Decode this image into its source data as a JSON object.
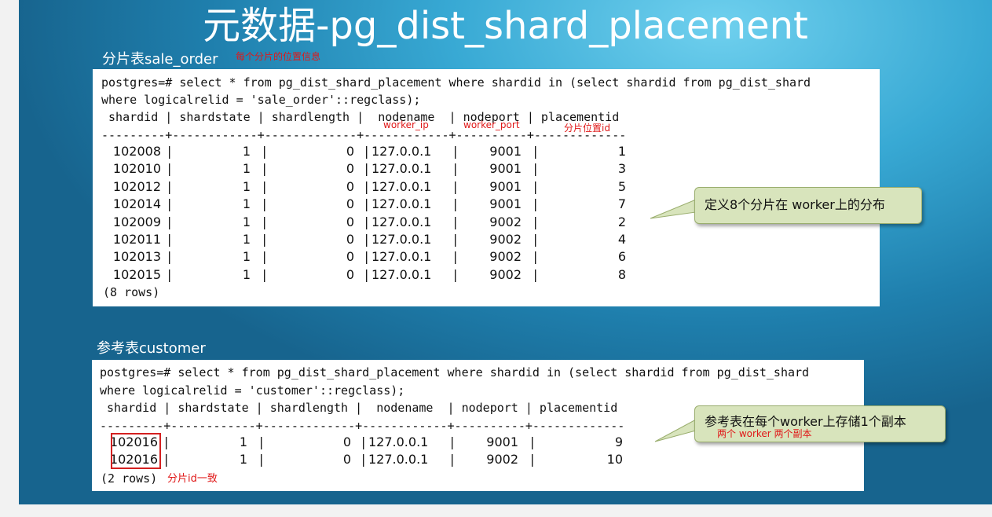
{
  "title": "元数据-pg_dist_shard_placement",
  "section1": {
    "label": "分片表sale_order",
    "note": "每个分片的位置信息",
    "query_line1": "postgres=# select * from pg_dist_shard_placement where shardid in (select shardid from pg_dist_shard",
    "query_line2": "where logicalrelid = 'sale_order'::regclass);",
    "header": " shardid | shardstate | shardlength |  nodename  | nodeport | placementid",
    "header_notes": {
      "nodename": "worker_ip",
      "nodeport": "worker_port",
      "placementid": "分片位置id"
    },
    "separator": "---------+------------+-------------+------------+----------+-------------",
    "rows": [
      [
        "102008",
        "1",
        "0",
        "127.0.0.1",
        "9001",
        "1"
      ],
      [
        "102010",
        "1",
        "0",
        "127.0.0.1",
        "9001",
        "3"
      ],
      [
        "102012",
        "1",
        "0",
        "127.0.0.1",
        "9001",
        "5"
      ],
      [
        "102014",
        "1",
        "0",
        "127.0.0.1",
        "9001",
        "7"
      ],
      [
        "102009",
        "1",
        "0",
        "127.0.0.1",
        "9002",
        "2"
      ],
      [
        "102011",
        "1",
        "0",
        "127.0.0.1",
        "9002",
        "4"
      ],
      [
        "102013",
        "1",
        "0",
        "127.0.0.1",
        "9002",
        "6"
      ],
      [
        "102015",
        "1",
        "0",
        "127.0.0.1",
        "9002",
        "8"
      ]
    ],
    "footer": "(8 rows)",
    "callout": "定义8个分片在 worker上的分布"
  },
  "section2": {
    "label": "参考表customer",
    "query_line1": "postgres=# select * from pg_dist_shard_placement where shardid in (select shardid from pg_dist_shard",
    "query_line2": "where logicalrelid = 'customer'::regclass);",
    "header": " shardid | shardstate | shardlength |  nodename  | nodeport | placementid",
    "separator": "---------+------------+-------------+------------+----------+-------------",
    "rows": [
      [
        "102016",
        "1",
        "0",
        "127.0.0.1",
        "9001",
        "9"
      ],
      [
        "102016",
        "1",
        "0",
        "127.0.0.1",
        "9002",
        "10"
      ]
    ],
    "footer": "(2 rows)",
    "footer_note": "分片id一致",
    "callout_main": "参考表在每个worker上存储1个副本",
    "callout_sub": "两个 worker 两个副本"
  }
}
